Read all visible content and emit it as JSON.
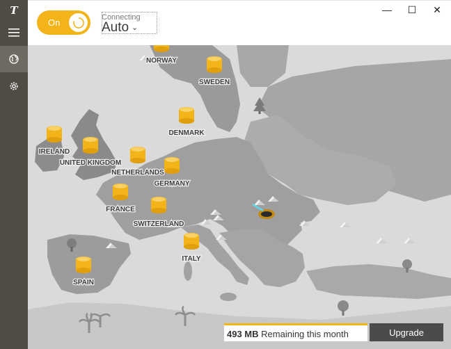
{
  "sidebar": {
    "logo_glyph": "T",
    "items": [
      {
        "icon": "hamburger-menu-icon"
      },
      {
        "icon": "globe-icon"
      },
      {
        "icon": "gear-icon"
      }
    ]
  },
  "header": {
    "toggle_label": "On",
    "status_small": "Connecting",
    "status_location": "Auto",
    "caret": "⌄"
  },
  "window_controls": {
    "minimize": "—",
    "maximize": "☐",
    "close": "✕"
  },
  "map": {
    "countries": [
      "NORWAY",
      "SWEDEN",
      "DENMARK",
      "IRELAND",
      "UNITED KINGDOM",
      "NETHERLANDS",
      "GERMANY",
      "FRANCE",
      "SWITZERLAND",
      "ITALY",
      "SPAIN"
    ]
  },
  "footer": {
    "data_amount": "493 MB",
    "data_text": " Remaining this month",
    "upgrade_label": "Upgrade"
  },
  "colors": {
    "accent": "#f2b418",
    "sidebar": "#4f4c43",
    "map_sea": "#dadada",
    "map_land": "#a3a3a3",
    "upgrade_bg": "#4b4b4b"
  }
}
